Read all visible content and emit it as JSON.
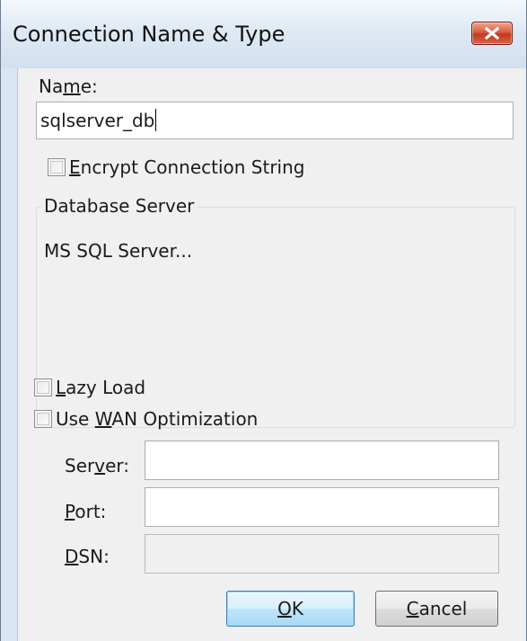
{
  "dialog": {
    "title": "Connection Name & Type"
  },
  "name_field": {
    "label_pre": "Na",
    "label_ul": "m",
    "label_post": "e:",
    "value": "sqlserver_db"
  },
  "encrypt": {
    "label_ul": "E",
    "label_post": "ncrypt Connection String",
    "checked": false
  },
  "database_server": {
    "group_title": "Database Server",
    "value": "MS SQL Server..."
  },
  "lazy_load": {
    "label_ul": "L",
    "label_post": "azy Load",
    "checked": false
  },
  "wan": {
    "label_pre": "Use ",
    "label_ul": "W",
    "label_post": "AN Optimization",
    "checked": false
  },
  "server_field": {
    "label_pre": "Ser",
    "label_ul": "v",
    "label_post": "er:",
    "value": ""
  },
  "port_field": {
    "label_ul": "P",
    "label_post": "ort:",
    "value": ""
  },
  "dsn_field": {
    "label_ul": "D",
    "label_post": "SN:",
    "value": "",
    "disabled": true
  },
  "buttons": {
    "ok_ul": "O",
    "ok_post": "K",
    "cancel_ul": "C",
    "cancel_post": "ancel"
  },
  "colors": {
    "titlebar": "#dfe9f4",
    "close_button": "#c2381f",
    "client_background": "#f0f0f0",
    "default_button": "#bee6fd"
  },
  "icons": {
    "close": "close-icon"
  }
}
